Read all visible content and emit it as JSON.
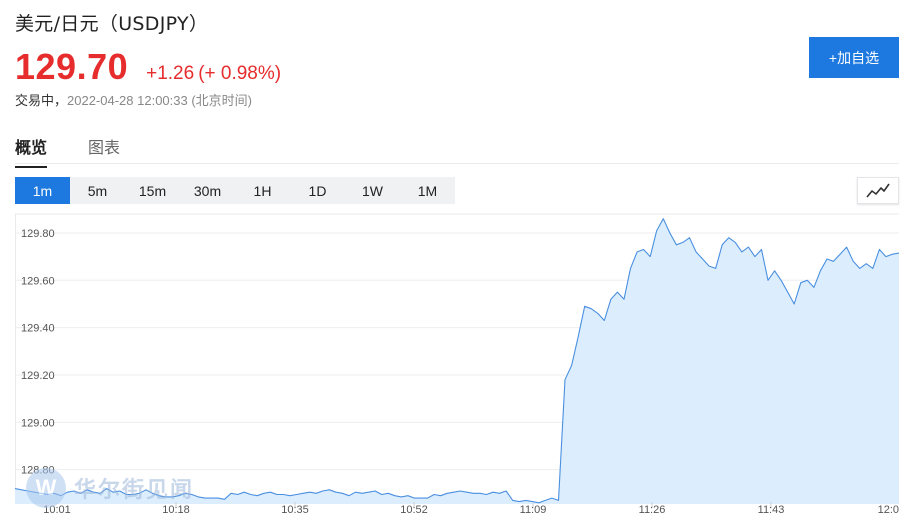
{
  "header": {
    "title": "美元/日元（USDJPY）",
    "price": "129.70",
    "change": "+1.26",
    "change_pct": "(+ 0.98%)",
    "status_label": "交易中，",
    "timestamp": "2022-04-28 12:00:33 (北京时间)",
    "add_watchlist_label": "+加自选"
  },
  "colors": {
    "accent": "#1d78e0",
    "up": "#e62c2c",
    "line": "#4a8fe0",
    "area": "#dceefe"
  },
  "tabs": [
    {
      "label": "概览",
      "active": true
    },
    {
      "label": "图表",
      "active": false
    }
  ],
  "periods": [
    {
      "label": "1m",
      "active": true
    },
    {
      "label": "5m",
      "active": false
    },
    {
      "label": "15m",
      "active": false
    },
    {
      "label": "30m",
      "active": false
    },
    {
      "label": "1H",
      "active": false
    },
    {
      "label": "1D",
      "active": false
    },
    {
      "label": "1W",
      "active": false
    },
    {
      "label": "1M",
      "active": false
    }
  ],
  "chart_type_icon": "line-chart-icon",
  "watermark": {
    "logo_letter": "W",
    "text": "华尔街见闻"
  },
  "chart_data": {
    "type": "area",
    "title": "",
    "xlabel": "",
    "ylabel": "",
    "ylim": [
      128.655,
      129.88
    ],
    "grid": true,
    "y_ticks": [
      "128.80",
      "129.00",
      "129.20",
      "129.40",
      "129.60",
      "129.80"
    ],
    "x_ticks": [
      "10:01",
      "10:18",
      "10:35",
      "10:52",
      "11:09",
      "11:26",
      "11:43",
      "12:0"
    ],
    "x_start": "10:01",
    "x_end": "12:00",
    "series": [
      {
        "values": [
          128.72,
          128.715,
          128.71,
          128.705,
          128.7,
          128.695,
          128.7,
          128.69,
          128.705,
          128.71,
          128.7,
          128.715,
          128.705,
          128.7,
          128.72,
          128.705,
          128.71,
          128.695,
          128.695,
          128.7,
          128.715,
          128.7,
          128.69,
          128.685,
          128.685,
          128.69,
          128.7,
          128.695,
          128.685,
          128.68,
          128.68,
          128.68,
          128.675,
          128.7,
          128.695,
          128.705,
          128.695,
          128.69,
          128.7,
          128.705,
          128.695,
          128.695,
          128.69,
          128.695,
          128.7,
          128.705,
          128.7,
          128.71,
          128.715,
          128.705,
          128.7,
          128.69,
          128.705,
          128.7,
          128.705,
          128.71,
          128.695,
          128.7,
          128.69,
          128.685,
          128.69,
          128.68,
          128.68,
          128.68,
          128.695,
          128.69,
          128.7,
          128.705,
          128.71,
          128.705,
          128.7,
          128.7,
          128.695,
          128.705,
          128.7,
          128.71,
          128.67,
          128.665,
          128.67,
          128.665,
          128.66,
          128.67,
          128.68,
          128.67,
          129.18,
          129.24,
          129.36,
          129.49,
          129.48,
          129.46,
          129.43,
          129.52,
          129.55,
          129.52,
          129.65,
          129.72,
          129.73,
          129.7,
          129.81,
          129.86,
          129.8,
          129.75,
          129.76,
          129.78,
          129.72,
          129.69,
          129.66,
          129.65,
          129.75,
          129.78,
          129.76,
          129.72,
          129.74,
          129.7,
          129.73,
          129.6,
          129.64,
          129.6,
          129.55,
          129.5,
          129.59,
          129.6,
          129.57,
          129.64,
          129.69,
          129.68,
          129.71,
          129.74,
          129.68,
          129.65,
          129.67,
          129.65,
          129.73,
          129.7,
          129.71,
          129.715
        ]
      }
    ]
  }
}
